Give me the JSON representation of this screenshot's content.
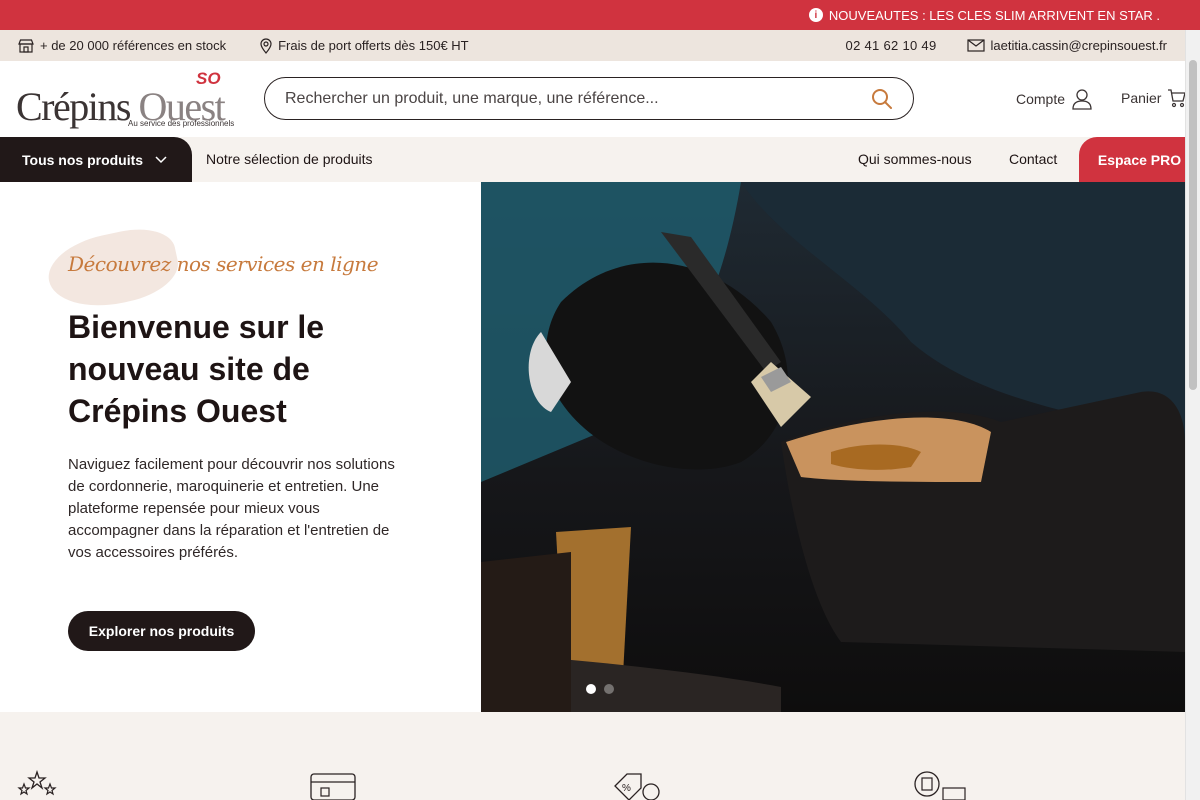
{
  "announcement": {
    "text": "NOUVEAUTES : LES CLES SLIM ARRIVENT EN STAR ."
  },
  "infobar": {
    "stock": "+ de 20 000 références en stock",
    "shipping": "Frais de port offerts dès 150€ HT",
    "phone": "02 41 62 10 49",
    "email": "laetitia.cassin@crepinsouest.fr"
  },
  "header": {
    "logo_text_a": "Crépins",
    "logo_text_b": "Ouest",
    "logo_tagline": "Au service des professionnels",
    "logo_mark": "SO",
    "search_placeholder": "Rechercher un produit, une marque, une référence...",
    "account_label": "Compte",
    "cart_label": "Panier"
  },
  "nav": {
    "all_products": "Tous nos produits",
    "selection": "Notre sélection de produits",
    "about": "Qui sommes-nous",
    "contact": "Contact",
    "pro": "Espace PRO"
  },
  "hero": {
    "script_heading": "Découvrez nos services en ligne",
    "title": "Bienvenue sur le nouveau site de Crépins Ouest",
    "description": "Naviguez facilement pour découvrir nos solutions de cordonnerie, maroquinerie et entretien. Une plateforme repensée pour mieux vous accompagner dans la réparation et l'entretien de vos accessoires préférés.",
    "cta": "Explorer nos produits",
    "slide_count": 2,
    "active_slide": 1
  },
  "colors": {
    "brand_red": "#d0333f",
    "dark": "#211818",
    "beige": "#ede5de",
    "accent_orange": "#c77a3d"
  },
  "features": {
    "icons": [
      "stars-icon",
      "card-icon",
      "discount-tag-icon",
      "delivery-icon"
    ]
  }
}
